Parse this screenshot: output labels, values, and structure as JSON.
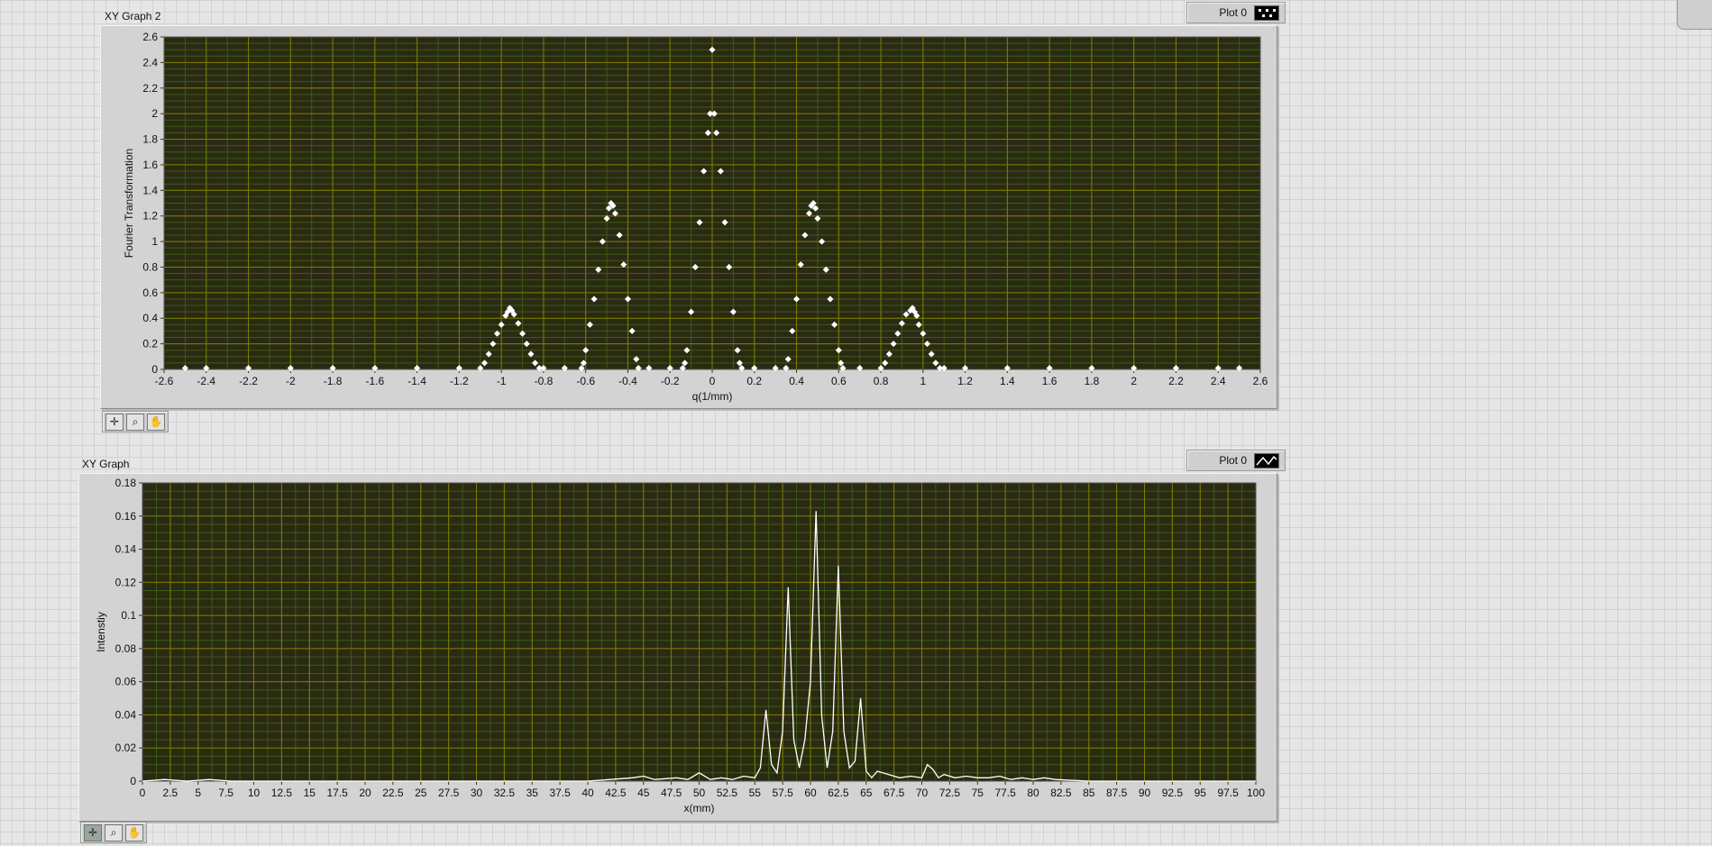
{
  "graph2": {
    "label": "XY Graph 2",
    "legend_label": "Plot 0",
    "legend_icon": "scatter-points-icon",
    "tools": [
      "cursor-tool-icon",
      "zoom-tool-icon",
      "pan-hand-tool-icon"
    ],
    "colors": {
      "plot_bg": "#2a2a12",
      "grid_major": "#7d7d00",
      "grid_minor": "#3d5a18",
      "trace": "#ffffff"
    }
  },
  "graph1": {
    "label": "XY Graph",
    "legend_label": "Plot 0",
    "legend_icon": "line-trace-icon",
    "tools": [
      "cursor-tool-icon",
      "zoom-tool-icon",
      "pan-hand-tool-icon"
    ]
  },
  "chart_data": [
    {
      "type": "scatter",
      "title": "XY Graph 2",
      "xlabel": "q(1/mm)",
      "ylabel": "Fourier  Transformation",
      "xlim": [
        -2.6,
        2.6
      ],
      "ylim": [
        0,
        2.6
      ],
      "xticks": [
        "-2.6",
        "-2.4",
        "-2.2",
        "-2",
        "-1.8",
        "-1.6",
        "-1.4",
        "-1.2",
        "-1",
        "-0.8",
        "-0.6",
        "-0.4",
        "-0.2",
        "0",
        "0.2",
        "0.4",
        "0.6",
        "0.8",
        "1",
        "1.2",
        "1.4",
        "1.6",
        "1.8",
        "2",
        "2.2",
        "2.4",
        "2.6"
      ],
      "yticks": [
        "0",
        "0.2",
        "0.4",
        "0.6",
        "0.8",
        "1",
        "1.2",
        "1.4",
        "1.6",
        "1.8",
        "2",
        "2.2",
        "2.4",
        "2.6"
      ],
      "grid": true,
      "series": [
        {
          "name": "Plot 0",
          "x": [
            -2.5,
            -2.4,
            -2.2,
            -2.0,
            -1.8,
            -1.6,
            -1.4,
            -1.2,
            -1.1,
            -1.08,
            -1.06,
            -1.04,
            -1.02,
            -1.0,
            -0.98,
            -0.97,
            -0.96,
            -0.95,
            -0.94,
            -0.92,
            -0.9,
            -0.88,
            -0.86,
            -0.84,
            -0.82,
            -0.8,
            -0.7,
            -0.62,
            -0.61,
            -0.6,
            -0.58,
            -0.56,
            -0.54,
            -0.52,
            -0.5,
            -0.49,
            -0.48,
            -0.47,
            -0.46,
            -0.44,
            -0.42,
            -0.4,
            -0.38,
            -0.36,
            -0.35,
            -0.3,
            -0.2,
            -0.14,
            -0.13,
            -0.12,
            -0.1,
            -0.08,
            -0.06,
            -0.04,
            -0.02,
            -0.01,
            0.0,
            0.01,
            0.02,
            0.04,
            0.06,
            0.08,
            0.1,
            0.12,
            0.13,
            0.14,
            0.2,
            0.3,
            0.35,
            0.36,
            0.38,
            0.4,
            0.42,
            0.44,
            0.46,
            0.47,
            0.48,
            0.49,
            0.5,
            0.52,
            0.54,
            0.56,
            0.58,
            0.6,
            0.61,
            0.62,
            0.7,
            0.8,
            0.82,
            0.84,
            0.86,
            0.88,
            0.9,
            0.92,
            0.94,
            0.95,
            0.96,
            0.97,
            0.98,
            1.0,
            1.02,
            1.04,
            1.06,
            1.08,
            1.1,
            1.2,
            1.4,
            1.6,
            1.8,
            2.0,
            2.2,
            2.4,
            2.5
          ],
          "y": [
            0.01,
            0.01,
            0.01,
            0.01,
            0.01,
            0.01,
            0.01,
            0.01,
            0.01,
            0.05,
            0.12,
            0.2,
            0.28,
            0.35,
            0.42,
            0.45,
            0.48,
            0.46,
            0.43,
            0.36,
            0.28,
            0.2,
            0.12,
            0.05,
            0.01,
            0.01,
            0.01,
            0.01,
            0.05,
            0.15,
            0.35,
            0.55,
            0.78,
            1.0,
            1.18,
            1.26,
            1.3,
            1.28,
            1.22,
            1.05,
            0.82,
            0.55,
            0.3,
            0.08,
            0.01,
            0.01,
            0.01,
            0.01,
            0.05,
            0.15,
            0.45,
            0.8,
            1.15,
            1.55,
            1.85,
            2.0,
            2.5,
            2.0,
            1.85,
            1.55,
            1.15,
            0.8,
            0.45,
            0.15,
            0.05,
            0.01,
            0.01,
            0.01,
            0.01,
            0.08,
            0.3,
            0.55,
            0.82,
            1.05,
            1.22,
            1.28,
            1.3,
            1.26,
            1.18,
            1.0,
            0.78,
            0.55,
            0.35,
            0.15,
            0.05,
            0.01,
            0.01,
            0.01,
            0.05,
            0.12,
            0.2,
            0.28,
            0.36,
            0.43,
            0.46,
            0.48,
            0.45,
            0.42,
            0.35,
            0.28,
            0.2,
            0.12,
            0.05,
            0.01,
            0.01,
            0.01,
            0.01,
            0.01,
            0.01,
            0.01,
            0.01,
            0.01,
            0.01
          ]
        }
      ]
    },
    {
      "type": "line",
      "title": "XY Graph",
      "xlabel": "x(mm)",
      "ylabel": "Intenstiy",
      "xlim": [
        0,
        100
      ],
      "ylim": [
        0,
        0.18
      ],
      "xticks": [
        "0",
        "2.5",
        "5",
        "7.5",
        "10",
        "12.5",
        "15",
        "17.5",
        "20",
        "22.5",
        "25",
        "27.5",
        "30",
        "32.5",
        "35",
        "37.5",
        "40",
        "42.5",
        "45",
        "47.5",
        "50",
        "52.5",
        "55",
        "57.5",
        "60",
        "62.5",
        "65",
        "67.5",
        "70",
        "72.5",
        "75",
        "77.5",
        "80",
        "82.5",
        "85",
        "87.5",
        "90",
        "92.5",
        "95",
        "97.5",
        "100"
      ],
      "yticks": [
        "0",
        "0.02",
        "0.04",
        "0.06",
        "0.08",
        "0.1",
        "0.12",
        "0.14",
        "0.16",
        "0.18"
      ],
      "grid": true,
      "series": [
        {
          "name": "Plot 0",
          "x": [
            0,
            2,
            4,
            6,
            8,
            10,
            20,
            30,
            40,
            42,
            44,
            45,
            46,
            48,
            49,
            50,
            51,
            52,
            53,
            54,
            55,
            55.5,
            56,
            56.5,
            57,
            57.5,
            58,
            58.5,
            59,
            59.5,
            60,
            60.5,
            61,
            61.5,
            62,
            62.5,
            63,
            63.5,
            64,
            64.5,
            65,
            65.5,
            66,
            67,
            68,
            69,
            70,
            70.5,
            71,
            71.5,
            72,
            73,
            74,
            75,
            76,
            77,
            78,
            79,
            80,
            81,
            82,
            85,
            90,
            95,
            100
          ],
          "y": [
            0,
            0.001,
            0,
            0.001,
            0,
            0,
            0,
            0,
            0,
            0.001,
            0.002,
            0.003,
            0.001,
            0.002,
            0.001,
            0.005,
            0.001,
            0.002,
            0.001,
            0.003,
            0.002,
            0.008,
            0.043,
            0.01,
            0.005,
            0.03,
            0.117,
            0.025,
            0.008,
            0.025,
            0.06,
            0.163,
            0.04,
            0.008,
            0.03,
            0.13,
            0.03,
            0.008,
            0.012,
            0.05,
            0.006,
            0.002,
            0.006,
            0.004,
            0.002,
            0.003,
            0.002,
            0.01,
            0.007,
            0.002,
            0.004,
            0.002,
            0.003,
            0.002,
            0.002,
            0.003,
            0.001,
            0.002,
            0.001,
            0.002,
            0.001,
            0,
            0,
            0,
            0
          ]
        }
      ]
    }
  ]
}
